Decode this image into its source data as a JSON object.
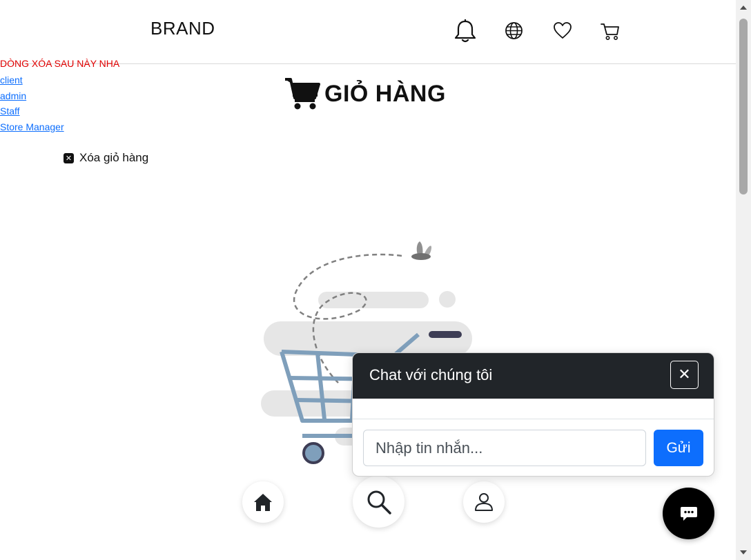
{
  "header": {
    "brand": "BRAND",
    "icons": [
      "bell-icon",
      "globe-icon",
      "heart-icon",
      "cart-icon"
    ]
  },
  "dev": {
    "note": "DÒNG XÓA SAU NÀY NHA",
    "links": [
      "client",
      "admin",
      "Staff",
      "Store Manager"
    ]
  },
  "cart": {
    "title": "GIỎ HÀNG",
    "clear_label": "Xóa giỏ hàng"
  },
  "bottom_nav": [
    "home-icon",
    "search-icon",
    "user-icon"
  ],
  "chat": {
    "title": "Chat với chúng tôi",
    "input_placeholder": "Nhập tin nhắn...",
    "send_label": "Gửi",
    "close_icon": "close-icon"
  },
  "colors": {
    "header_dark": "#212529",
    "primary": "#0d6efd",
    "dev_note": "#e00000",
    "cart_line": "#7f9fbb"
  }
}
